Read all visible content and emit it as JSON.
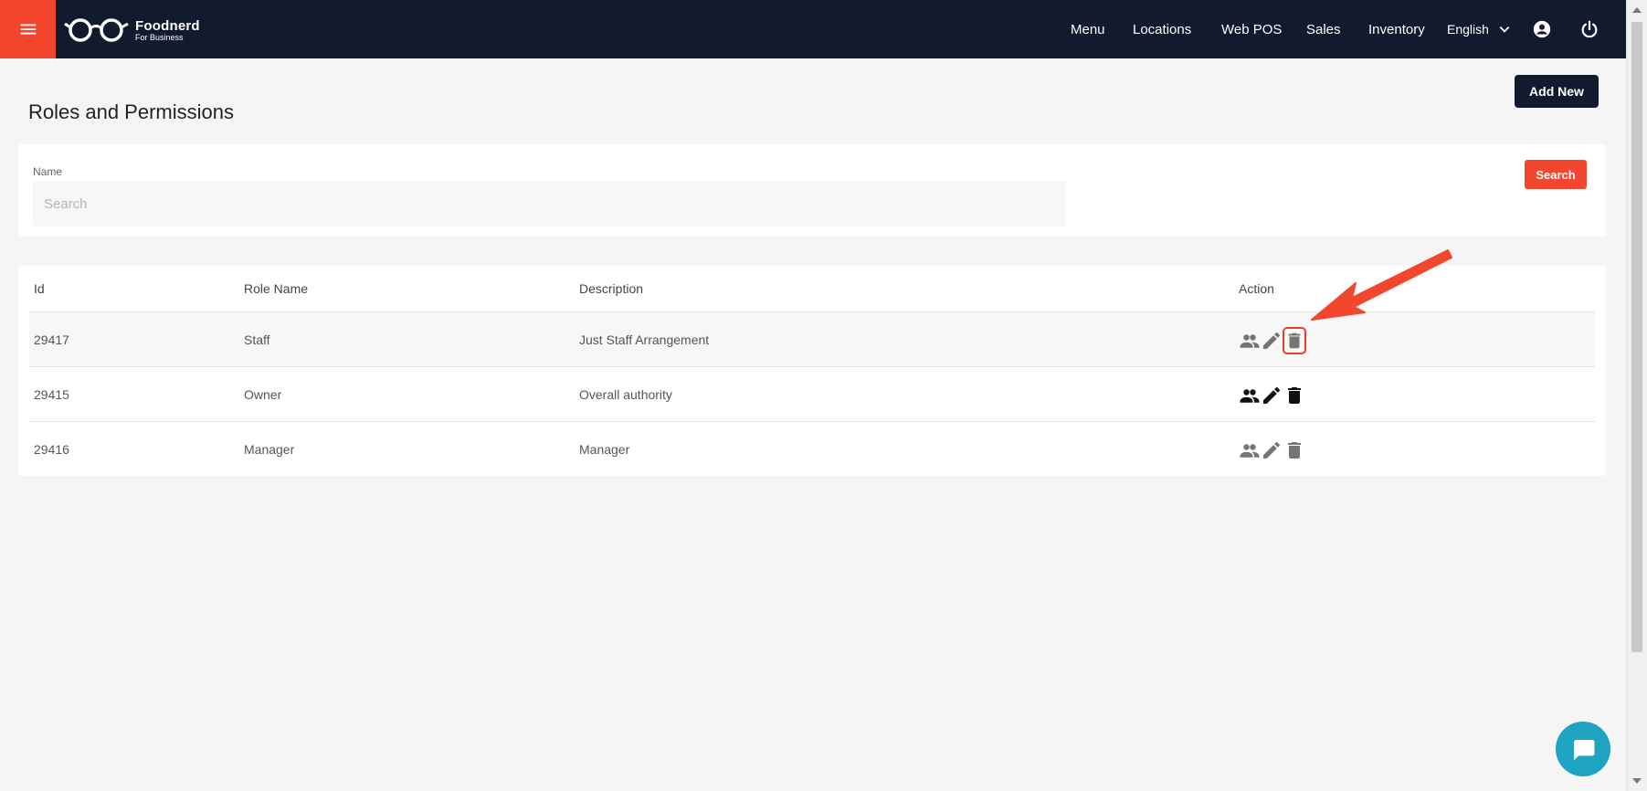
{
  "brand": {
    "title": "Foodnerd",
    "subtitle": "For Business"
  },
  "nav": {
    "items": [
      {
        "label": "Menu"
      },
      {
        "label": "Locations"
      },
      {
        "label": "Web POS"
      },
      {
        "label": "Sales"
      },
      {
        "label": "Inventory"
      }
    ],
    "language": "English"
  },
  "page": {
    "title": "Roles and Permissions",
    "add_button": "Add New"
  },
  "search": {
    "label": "Name",
    "placeholder": "Search",
    "value": "",
    "button": "Search"
  },
  "table": {
    "headers": {
      "id": "Id",
      "role": "Role Name",
      "description": "Description",
      "action": "Action"
    },
    "rows": [
      {
        "id": "29417",
        "role": "Staff",
        "description": "Just Staff Arrangement",
        "icon_color": "#757575",
        "highlighted": true
      },
      {
        "id": "29415",
        "role": "Owner",
        "description": "Overall authority",
        "icon_color": "#111111",
        "highlighted": false
      },
      {
        "id": "29416",
        "role": "Manager",
        "description": "Manager",
        "icon_color": "#757575",
        "highlighted": false
      }
    ]
  },
  "icons": {
    "menu": "hamburger-icon",
    "glasses_logo": "glasses-icon",
    "language_chevron": "chevron-down-icon",
    "account": "account-circle-icon",
    "power": "power-icon",
    "row_actions": [
      "people-icon",
      "pencil-icon",
      "trash-icon"
    ],
    "chat": "chat-icon"
  },
  "colors": {
    "topbar": "#121a2e",
    "accent": "#f2462e",
    "chat": "#1ea3c0",
    "annotation": "#e8412c"
  }
}
